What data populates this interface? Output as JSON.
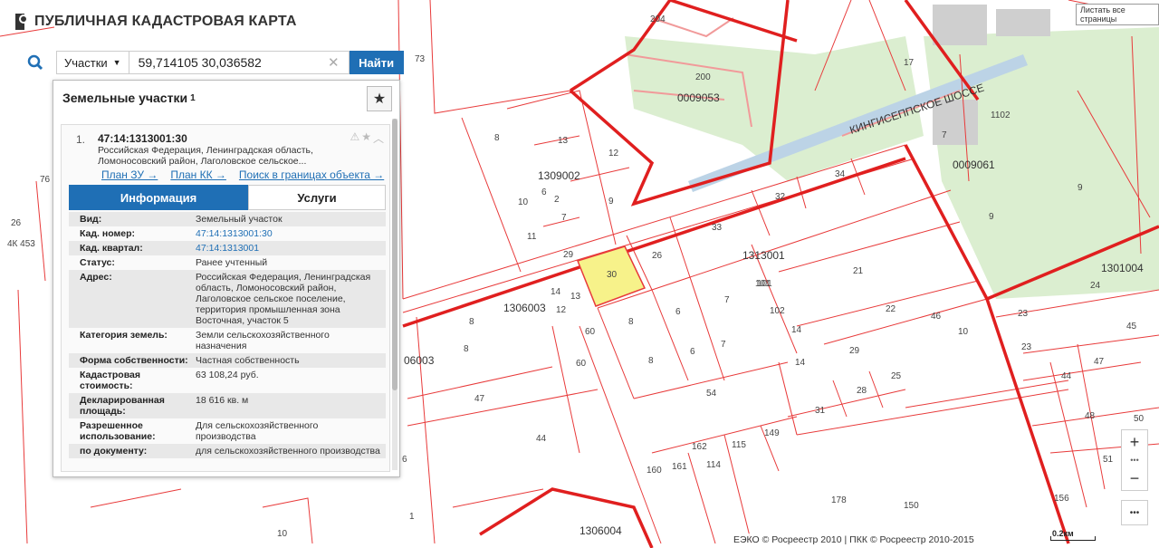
{
  "app_title": "ПУБЛИЧНАЯ КАДАСТРОВАЯ КАРТА",
  "tooltip": "Листать все страницы",
  "search": {
    "type_label": "Участки",
    "query": "59,714105 30,036582",
    "find_label": "Найти"
  },
  "panel": {
    "heading": "Земельные участки",
    "count": "1",
    "result": {
      "number": "1.",
      "cad_number": "47:14:1313001:30",
      "address_short": "Российская Федерация, Ленинградская область, Ломоносовский район, Лаголовское сельское...",
      "links": [
        "План ЗУ →",
        "План КК →",
        "Поиск в границах объекта →"
      ]
    },
    "tabs": [
      "Информация",
      "Услуги"
    ],
    "props": [
      {
        "k": "Вид:",
        "v": "Земельный участок"
      },
      {
        "k": "Кад. номер:",
        "v": "47:14:1313001:30",
        "link": true
      },
      {
        "k": "Кад. квартал:",
        "v": "47:14:1313001",
        "link": true
      },
      {
        "k": "Статус:",
        "v": "Ранее учтенный"
      },
      {
        "k": "Адрес:",
        "v": "Российская Федерация, Ленинградская область, Ломоносовский район, Лаголовское сельское поселение, территория промышленная зона Восточная, участок 5"
      },
      {
        "k": "Категория земель:",
        "v": "Земли сельскохозяйственного назначения"
      },
      {
        "k": "Форма собственности:",
        "v": "Частная собственность"
      },
      {
        "k": "Кадастровая стоимость:",
        "v": "63 108,24 руб."
      },
      {
        "k": "Декларированная площадь:",
        "v": "18 616 кв. м"
      },
      {
        "k": "Разрешенное использование:",
        "v": "Для сельскохозяйственного производства"
      },
      {
        "k": "по документу:",
        "v": "для сельскохозяйственного производства"
      }
    ]
  },
  "map": {
    "road_label": "КИНГИСЕППСКОЕ ШОССЕ",
    "selected_parcel": "30",
    "copyright": "ЕЭКО © Росреестр 2010 | ПКК © Росреестр 2010-2015",
    "scale": "0.2км",
    "quarters": [
      "1313001",
      "1309002",
      "1306003",
      "1306004",
      "1301004",
      "0009053",
      "0009061",
      "06003"
    ],
    "parcels": [
      "73",
      "8",
      "13",
      "12",
      "10",
      "6",
      "2",
      "7",
      "11",
      "9",
      "29",
      "26",
      "33",
      "32",
      "34",
      "21",
      "101",
      "102",
      "22",
      "46",
      "10",
      "14",
      "14",
      "29",
      "25",
      "28",
      "31",
      "8",
      "6",
      "7",
      "8",
      "6",
      "7",
      "60",
      "60",
      "54",
      "47",
      "44",
      "149",
      "115",
      "114",
      "161",
      "160",
      "162",
      "178",
      "150",
      "23",
      "23",
      "45",
      "44",
      "47",
      "48",
      "50",
      "51",
      "24",
      "9",
      "9",
      "7",
      "1102",
      "204",
      "200",
      "17",
      "76",
      "26",
      "4К 453",
      "1",
      "6",
      "10",
      "14",
      "13",
      "12",
      "8",
      "8",
      "101",
      "156"
    ]
  },
  "colors": {
    "accent": "#1f6fb5",
    "parcel_line": "#e83a3a",
    "selected": "#f7f28a",
    "park": "#dbeed0"
  }
}
